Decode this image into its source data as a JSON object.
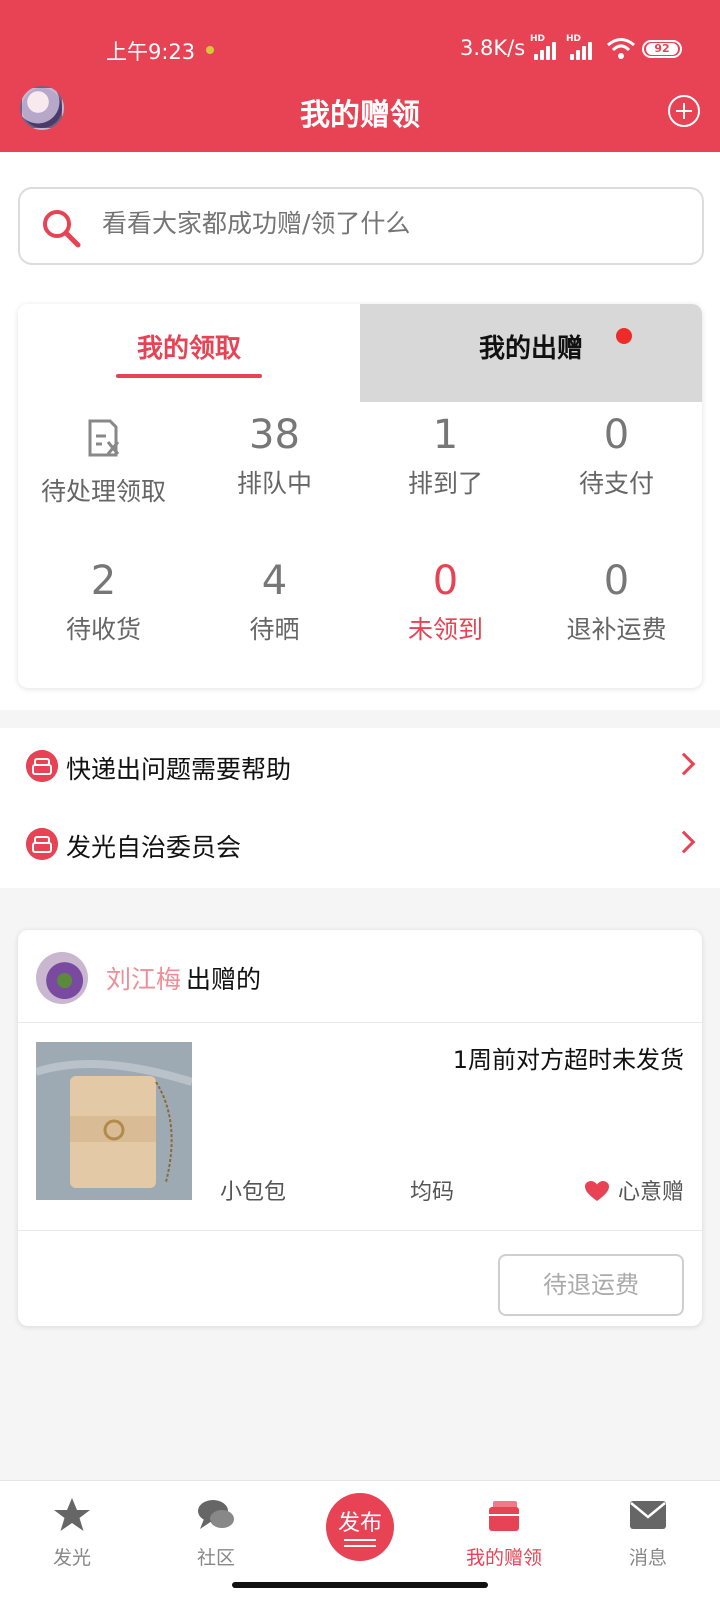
{
  "status_bar": {
    "time": "上午9:23",
    "net_speed": "3.8K/s",
    "signal_label": "HD",
    "battery": "92"
  },
  "header": {
    "title": "我的赠领"
  },
  "search": {
    "placeholder": "看看大家都成功赠/领了什么"
  },
  "tabs": [
    {
      "label": "我的领取",
      "active": true
    },
    {
      "label": "我的出赠",
      "active": false,
      "has_dot": true
    }
  ],
  "stats": [
    {
      "value": "",
      "label": "待处理领取",
      "icon": "document-icon"
    },
    {
      "value": "38",
      "label": "排队中"
    },
    {
      "value": "1",
      "label": "排到了"
    },
    {
      "value": "0",
      "label": "待支付"
    },
    {
      "value": "2",
      "label": "待收货"
    },
    {
      "value": "4",
      "label": "待晒"
    },
    {
      "value": "0",
      "label": "未领到",
      "highlight": true
    },
    {
      "value": "0",
      "label": "退补运费"
    }
  ],
  "links": [
    {
      "label": "快递出问题需要帮助",
      "icon": "help-icon"
    },
    {
      "label": "发光自治委员会",
      "icon": "committee-icon"
    }
  ],
  "order": {
    "giver_name": "刘江梅",
    "giver_suffix": "出赠的",
    "status": "1周前对方超时未发货",
    "item_name": "小包包",
    "item_size": "均码",
    "gift_type": "心意赠",
    "action": "待退运费"
  },
  "bottom_nav": [
    {
      "label": "发光",
      "icon": "star-icon"
    },
    {
      "label": "社区",
      "icon": "chat-icon"
    },
    {
      "label": "发布",
      "icon": "publish-icon"
    },
    {
      "label": "我的赠领",
      "icon": "gift-box-icon",
      "active": true
    },
    {
      "label": "消息",
      "icon": "mail-icon"
    }
  ],
  "colors": {
    "accent": "#e84354",
    "inactive_tab": "#d8d8d8"
  }
}
